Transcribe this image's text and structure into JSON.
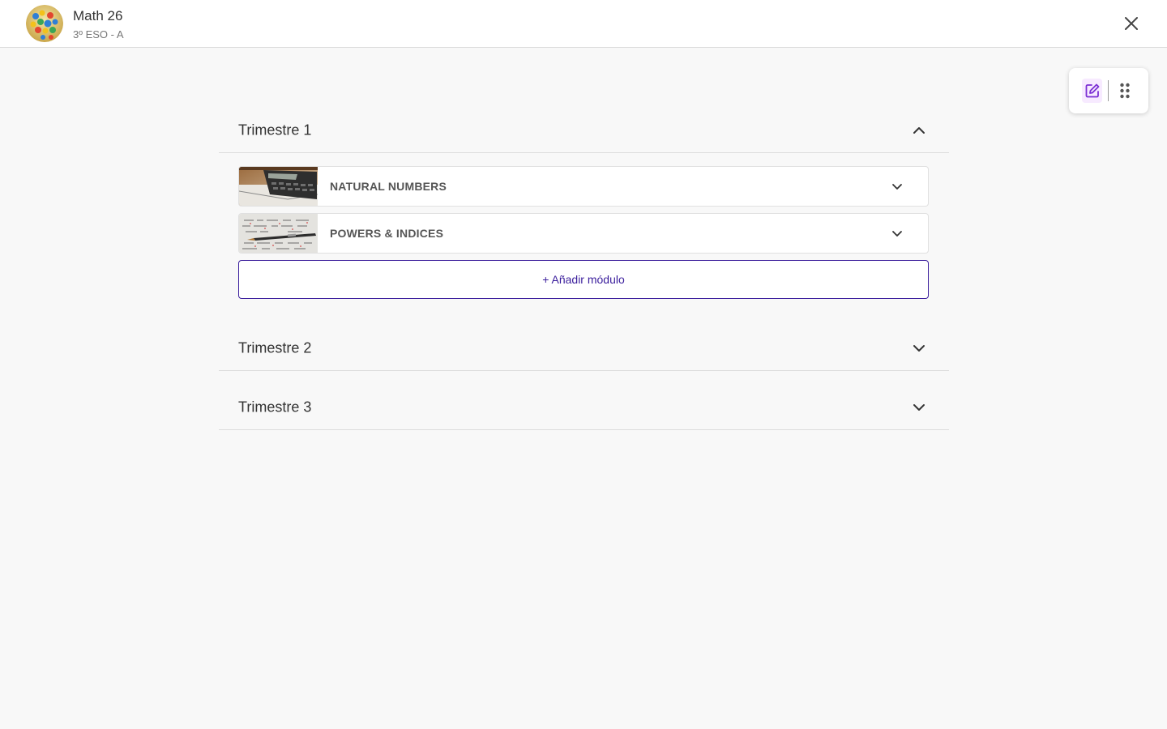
{
  "header": {
    "title": "Math 26",
    "subtitle": "3º ESO - A",
    "avatar_icon": "course-avatar",
    "close_icon": "close-icon"
  },
  "toolbox": {
    "edit_icon": "edit-icon",
    "drag_icon": "drag-handle-icon",
    "edit_active_bg": "#f7eaff",
    "edit_color": "#7b2fd4"
  },
  "sections": [
    {
      "title": "Trimestre 1",
      "expanded": true,
      "modules": [
        {
          "label": "NATURAL NUMBERS",
          "thumb": "calculator-image"
        },
        {
          "label": "POWERS & INDICES",
          "thumb": "handwriting-pen-image"
        }
      ],
      "add_label": "+ Añadir módulo"
    },
    {
      "title": "Trimestre 2",
      "expanded": false
    },
    {
      "title": "Trimestre 3",
      "expanded": false
    }
  ],
  "colors": {
    "accent": "#3a1d9c",
    "background": "#f8f8f8",
    "divider": "#dddddd"
  }
}
